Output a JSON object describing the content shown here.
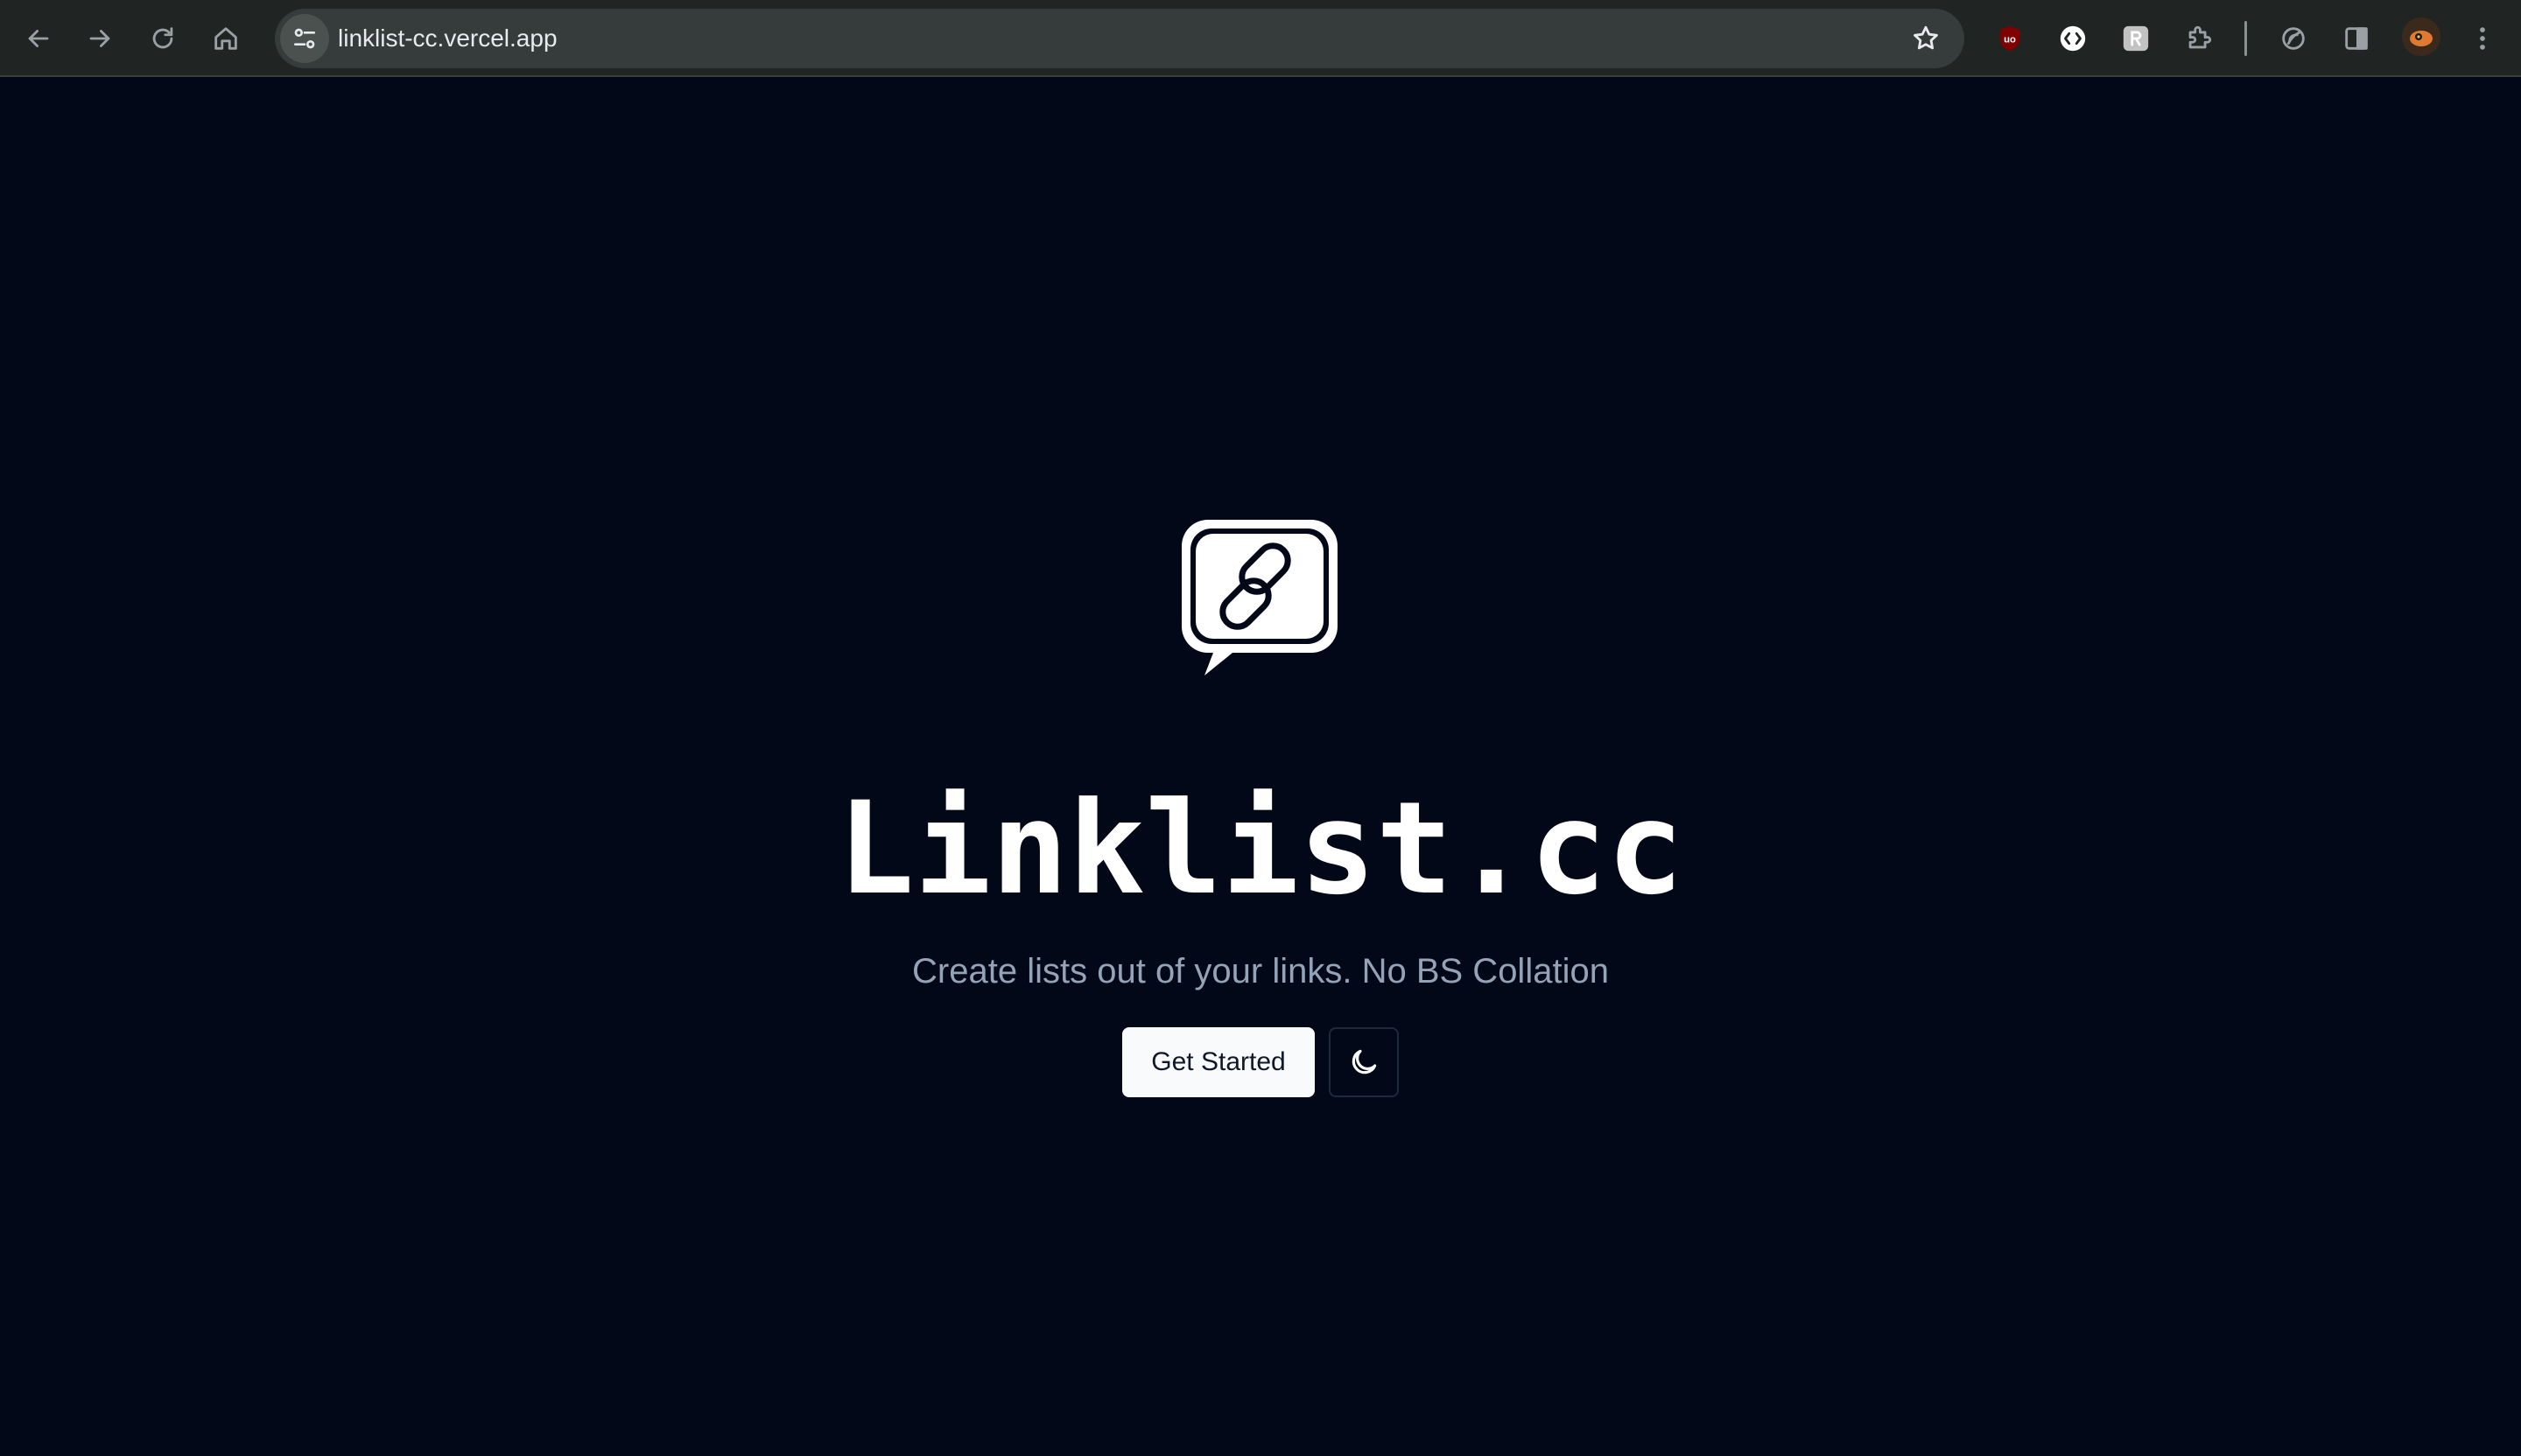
{
  "browser": {
    "url": "linklist-cc.vercel.app",
    "icons": {
      "back": "arrow-left-icon",
      "forward": "arrow-right-icon",
      "reload": "reload-icon",
      "home": "home-icon",
      "site_info": "tune-icon",
      "bookmark": "star-icon",
      "extensions": [
        "ublock-icon",
        "code-bracket-icon",
        "rust-icon",
        "puzzle-icon",
        "leaf-icon",
        "sidepanel-icon"
      ],
      "menu": "kebab-menu-icon"
    }
  },
  "page": {
    "brand": "Linklist.cc",
    "tagline": "Create lists out of your links. No BS Collation",
    "cta_label": "Get Started",
    "theme_icon": "moon-icon",
    "colors": {
      "background": "#020817",
      "primary_button": "#f8fafc",
      "tagline": "#94a3b8"
    }
  }
}
